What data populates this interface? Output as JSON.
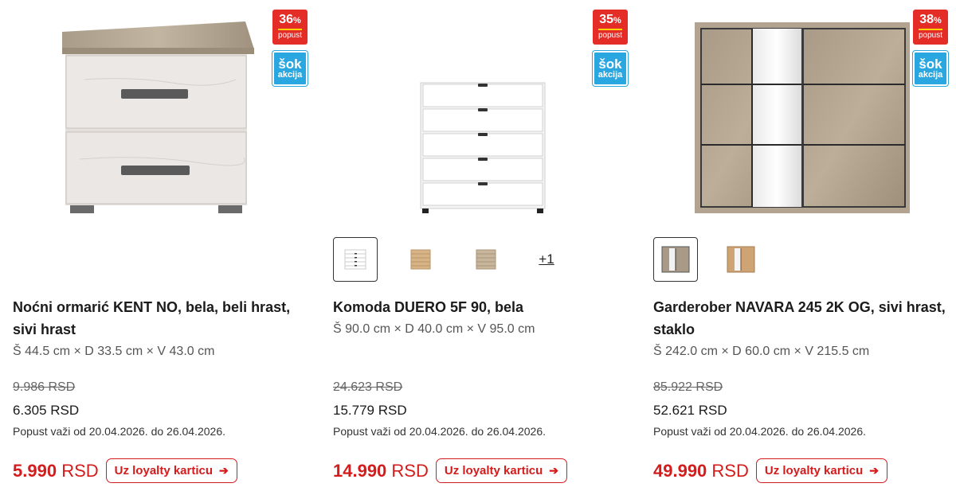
{
  "colors": {
    "discount_badge": "#e52d27",
    "sok_badge": "#2aa7e0",
    "loyalty_red": "#d41c1c"
  },
  "products": [
    {
      "discount_value": "36",
      "discount_percent_sign": "%",
      "discount_label": "popust",
      "sok_line1": "šok",
      "sok_line2": "akcija",
      "title": "Noćni ormarić KENT NO, bela, beli hrast, sivi hrast",
      "dimensions": "Š 44.5 cm × D 33.5 cm × V 43.0 cm",
      "old_price": "9.986 RSD",
      "new_price": "6.305 RSD",
      "promo_text": "Popust važi od 20.04.2026. do 26.04.2026.",
      "loyalty_amount": "5.990",
      "loyalty_currency": "RSD",
      "loyalty_button_label": "Uz loyalty karticu",
      "arrow_icon": "arrow-right-icon"
    },
    {
      "discount_value": "35",
      "discount_percent_sign": "%",
      "discount_label": "popust",
      "sok_line1": "šok",
      "sok_line2": "akcija",
      "title": "Komoda DUERO 5F 90, bela",
      "dimensions": "Š 90.0 cm × D 40.0 cm × V 95.0 cm",
      "swatch_more": "+1",
      "old_price": "24.623 RSD",
      "new_price": "15.779 RSD",
      "promo_text": "Popust važi od 20.04.2026. do 26.04.2026.",
      "loyalty_amount": "14.990",
      "loyalty_currency": "RSD",
      "loyalty_button_label": "Uz loyalty karticu",
      "arrow_icon": "arrow-right-icon"
    },
    {
      "discount_value": "38",
      "discount_percent_sign": "%",
      "discount_label": "popust",
      "sok_line1": "šok",
      "sok_line2": "akcija",
      "title": "Garderober NAVARA 245 2K OG, sivi hrast, staklo",
      "dimensions": "Š 242.0 cm × D 60.0 cm × V 215.5 cm",
      "old_price": "85.922 RSD",
      "new_price": "52.621 RSD",
      "promo_text": "Popust važi od 20.04.2026. do 26.04.2026.",
      "loyalty_amount": "49.990",
      "loyalty_currency": "RSD",
      "loyalty_button_label": "Uz loyalty karticu",
      "arrow_icon": "arrow-right-icon"
    }
  ]
}
